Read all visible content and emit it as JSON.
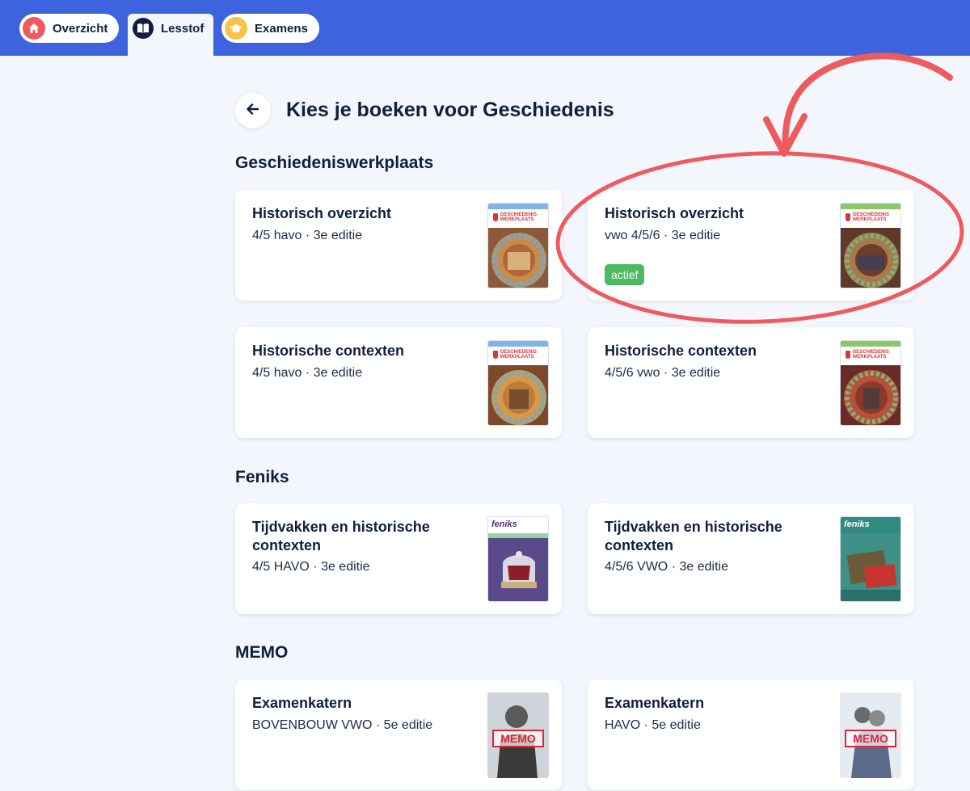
{
  "nav": {
    "tabs": [
      {
        "label": "Overzicht",
        "icon": "home-icon",
        "active": false
      },
      {
        "label": "Lesstof",
        "icon": "book-icon",
        "active": true
      },
      {
        "label": "Examens",
        "icon": "graduation-cap-icon",
        "active": false
      }
    ]
  },
  "page": {
    "title": "Kies je boeken voor Geschiedenis"
  },
  "sections": [
    {
      "title": "Geschiedeniswerkplaats",
      "cards": [
        {
          "title": "Historisch overzicht",
          "subtitle": "4/5 havo  ·  3e editie",
          "badge": ""
        },
        {
          "title": "Historisch overzicht",
          "subtitle": "vwo 4/5/6  ·  3e editie",
          "badge": "actief"
        },
        {
          "title": "Historische contexten",
          "subtitle": "4/5 havo  ·  3e editie",
          "badge": ""
        },
        {
          "title": "Historische contexten",
          "subtitle": "4/5/6 vwo  ·  3e editie",
          "badge": ""
        }
      ]
    },
    {
      "title": "Feniks",
      "cards": [
        {
          "title": "Tijdvakken en historische contexten",
          "subtitle": "4/5 HAVO  ·  3e editie"
        },
        {
          "title": "Tijdvakken en historische contexten",
          "subtitle": "4/5/6 VWO  ·  3e editie"
        }
      ]
    },
    {
      "title": "MEMO",
      "cards": [
        {
          "title": "Examenkatern",
          "subtitle": "BOVENBOUW VWO  ·  5e editie"
        },
        {
          "title": "Examenkatern",
          "subtitle": "HAVO  ·  5e editie"
        }
      ]
    }
  ],
  "covers": {
    "geschiedeniswerkplaats_brand": "GESCHIEDENIS WERKPLAATS",
    "feniks_brand": "feniks",
    "memo_brand": "MEMO"
  },
  "colors": {
    "topbar": "#3d63de",
    "background": "#f3f7fd",
    "text": "#0f1f3d",
    "badge": "#4cb963",
    "annotation": "#ef5a5f",
    "home_icon_bg": "#ef5a5f",
    "exam_icon_bg": "#f7c546"
  }
}
